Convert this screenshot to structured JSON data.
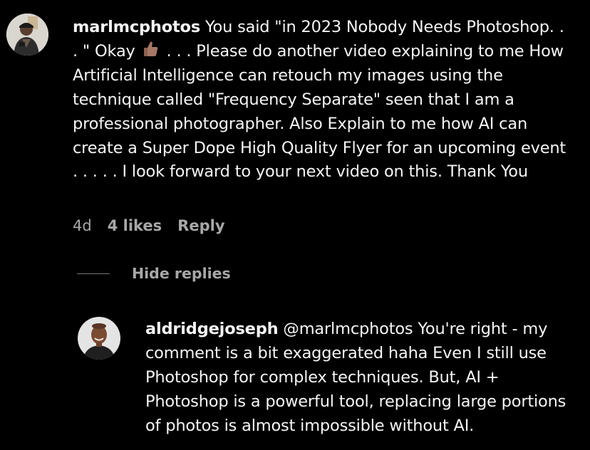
{
  "comments": [
    {
      "username": "marlmcphotos",
      "text_part1": " You said \"in 2023 Nobody Needs Photoshop. . . \" Okay ",
      "emoji_name": "thumbs-up-emoji",
      "text_part2": " . . . Please do another video explaining to me How Artificial Intelligence can retouch my images using the technique called \"Frequency Separate\" seen that I am a professional photographer. Also Explain to me how AI can create a Super Dope High Quality Flyer for an upcoming event . . . . . I look forward to your next video on this. Thank You",
      "age": "4d",
      "likes": "4 likes",
      "reply_label": "Reply",
      "avatar_icon": "user-avatar-photo"
    }
  ],
  "replies_toggle": {
    "label": "Hide replies"
  },
  "replies": [
    {
      "username": "aldridgejoseph",
      "text": " @marlmcphotos You're right - my comment is a bit exaggerated haha Even I still use Photoshop for complex techniques. But, AI + Photoshop is a powerful tool, replacing large portions of photos is almost impossible without AI.",
      "avatar_icon": "user-avatar-photo"
    }
  ],
  "colors": {
    "background": "#000000",
    "primary_text": "#f5f5f5",
    "secondary_text": "#a8a8a8",
    "divider": "#737373"
  }
}
